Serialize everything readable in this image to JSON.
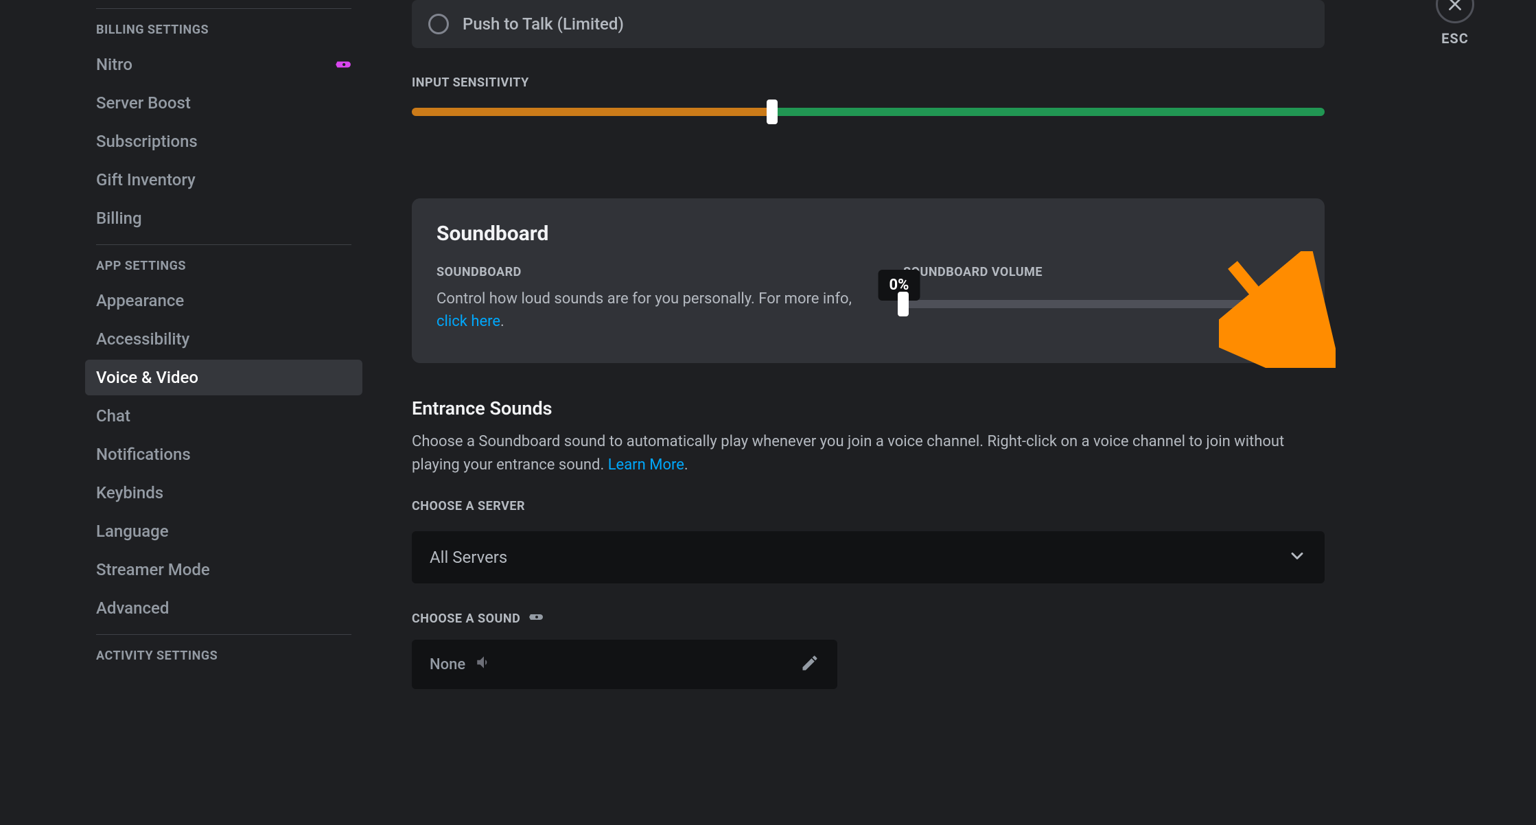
{
  "close": {
    "label": "ESC"
  },
  "sidebar": {
    "billing_header": "BILLING SETTINGS",
    "app_header": "APP SETTINGS",
    "activity_header": "ACTIVITY SETTINGS",
    "billing_items": [
      {
        "label": "Nitro",
        "badge": true
      },
      {
        "label": "Server Boost"
      },
      {
        "label": "Subscriptions"
      },
      {
        "label": "Gift Inventory"
      },
      {
        "label": "Billing"
      }
    ],
    "app_items": [
      {
        "label": "Appearance"
      },
      {
        "label": "Accessibility"
      },
      {
        "label": "Voice & Video",
        "active": true
      },
      {
        "label": "Chat"
      },
      {
        "label": "Notifications"
      },
      {
        "label": "Keybinds"
      },
      {
        "label": "Language"
      },
      {
        "label": "Streamer Mode"
      },
      {
        "label": "Advanced"
      }
    ]
  },
  "radio": {
    "label": "Push to Talk (Limited)"
  },
  "sensitivity": {
    "label": "INPUT SENSITIVITY"
  },
  "soundboard": {
    "title": "Soundboard",
    "subheader": "SOUNDBOARD",
    "desc_pre": "Control how loud sounds are for you personally. For more info, ",
    "desc_link": "click here",
    "desc_post": ".",
    "volume_label": "SOUNDBOARD VOLUME",
    "tooltip": "0%"
  },
  "entrance": {
    "title": "Entrance Sounds",
    "desc_pre": "Choose a Soundboard sound to automatically play whenever you join a voice channel. Right-click on a voice channel to join without playing your entrance sound. ",
    "desc_link": "Learn More",
    "desc_post": ".",
    "server_label": "CHOOSE A SERVER",
    "server_value": "All Servers",
    "sound_label": "CHOOSE A SOUND",
    "sound_value": "None"
  }
}
